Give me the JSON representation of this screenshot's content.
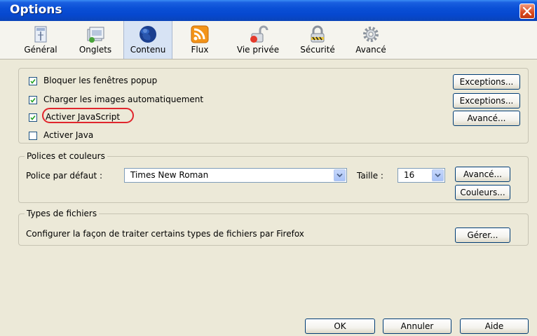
{
  "window": {
    "title": "Options"
  },
  "tabs": [
    {
      "label": "Général",
      "icon": "general-icon"
    },
    {
      "label": "Onglets",
      "icon": "tabs-icon"
    },
    {
      "label": "Contenu",
      "icon": "globe-icon",
      "active": true
    },
    {
      "label": "Flux",
      "icon": "feed-icon"
    },
    {
      "label": "Vie privée",
      "icon": "privacy-lock-icon"
    },
    {
      "label": "Sécurité",
      "icon": "security-lock-icon"
    },
    {
      "label": "Avancé",
      "icon": "gear-icon"
    }
  ],
  "content": {
    "checkboxes": [
      {
        "label": "Bloquer les fenêtres popup",
        "checked": true
      },
      {
        "label": "Charger les images automatiquement",
        "checked": true
      },
      {
        "label": "Activer JavaScript",
        "checked": true
      },
      {
        "label": "Activer Java",
        "checked": false
      }
    ],
    "exceptions_popup": "Exceptions...",
    "exceptions_images": "Exceptions...",
    "advanced_js": "Avancé..."
  },
  "fonts": {
    "title": "Polices et couleurs",
    "default_font_label": "Police par défaut :",
    "default_font_value": "Times New Roman",
    "size_label": "Taille :",
    "size_value": "16",
    "advanced_button": "Avancé...",
    "colors_button": "Couleurs..."
  },
  "filetypes": {
    "title": "Types de fichiers",
    "description": "Configurer la façon de traiter certains types de fichiers par Firefox",
    "manage_button": "Gérer..."
  },
  "footer": {
    "ok": "OK",
    "cancel": "Annuler",
    "help": "Aide"
  },
  "colors": {
    "titlebar": "#0a4fd6",
    "highlight_ring": "#e0262d",
    "active_tab": "#d7e3f4"
  }
}
